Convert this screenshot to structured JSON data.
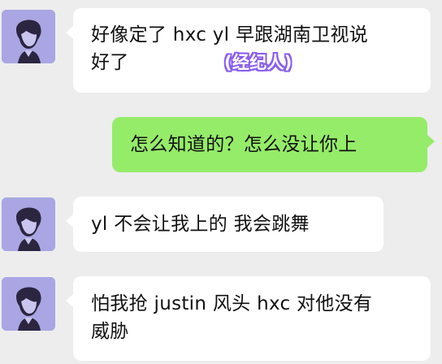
{
  "messages": [
    {
      "sender": "other",
      "line1": "好像定了 hxc  yl 早跟湖南卫视说",
      "line2": "好了",
      "annotation": "(经纪人)"
    },
    {
      "sender": "self",
      "text": "怎么知道的？怎么没让你上"
    },
    {
      "sender": "other",
      "text": "yl 不会让我上的 我会跳舞"
    },
    {
      "sender": "other",
      "line1": "怕我抢 justin 风头  hxc 对他没有",
      "line2": "威胁"
    }
  ],
  "colors": {
    "background": "#ededed",
    "incoming_bubble": "#ffffff",
    "outgoing_bubble": "#95ec69",
    "avatar_bg": "#a9a6e3",
    "annotation": "#8a5cf0"
  },
  "avatar_icon": "person-sketch-icon"
}
